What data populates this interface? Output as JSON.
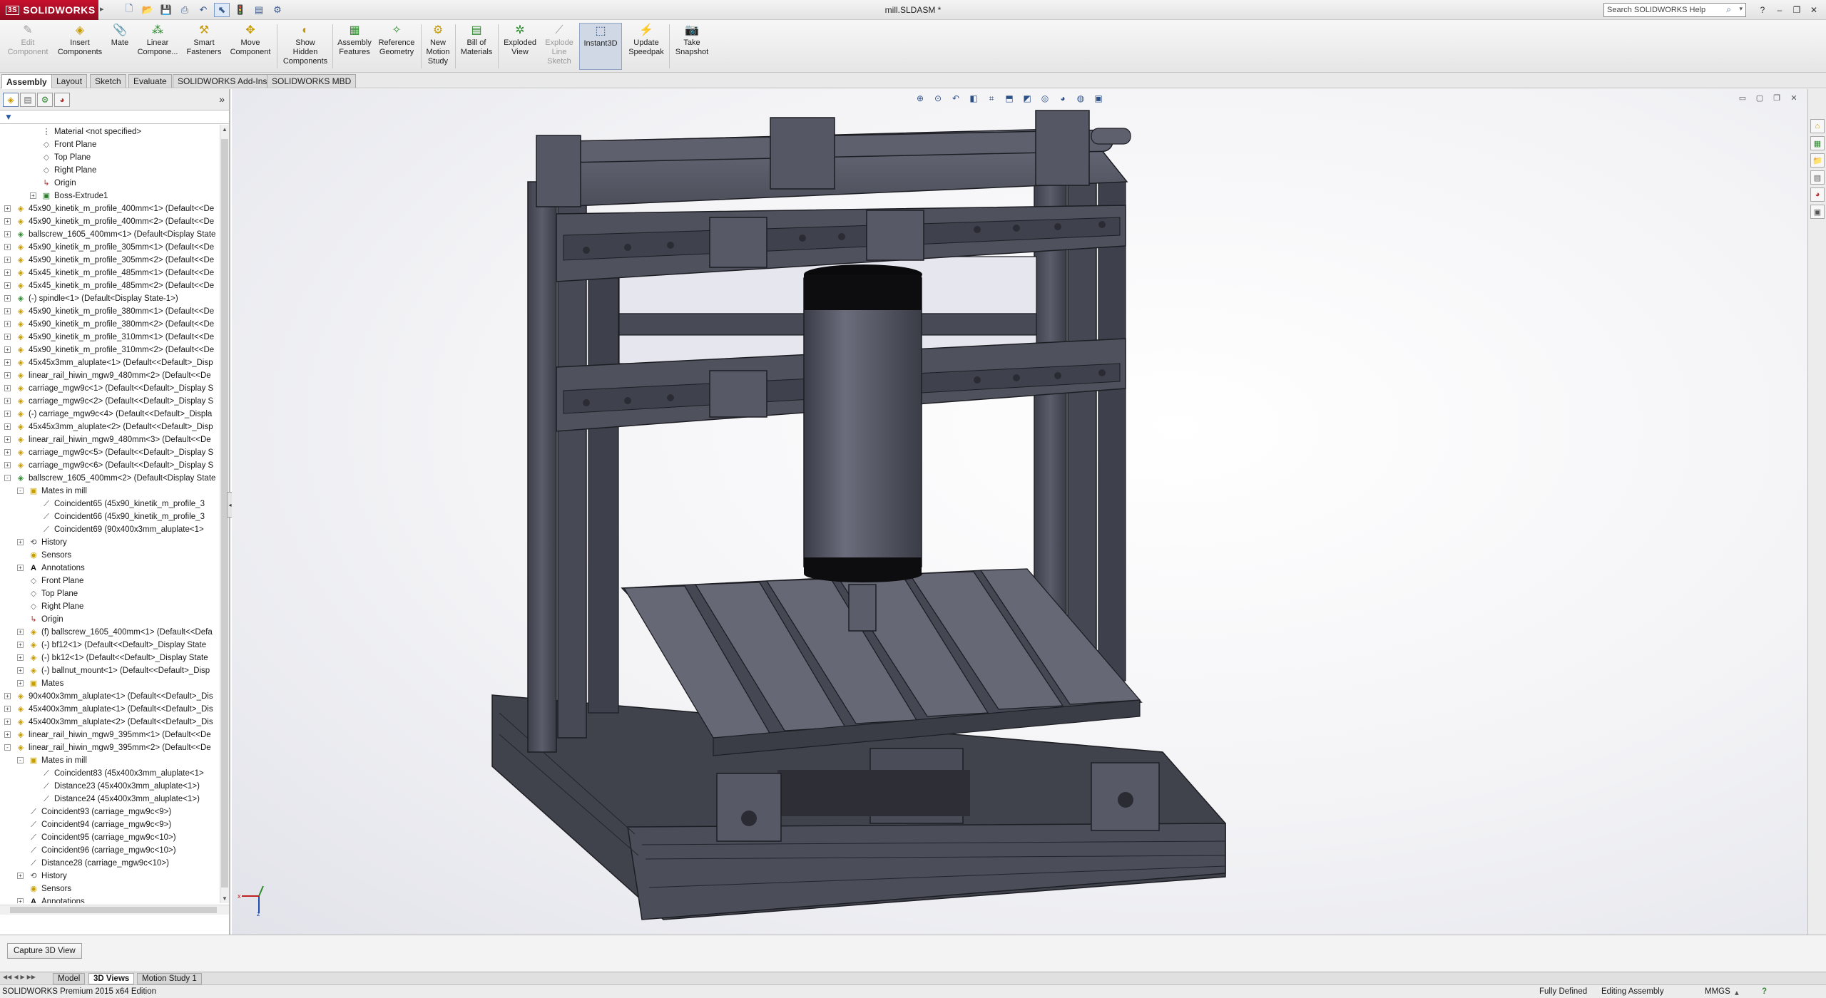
{
  "app": {
    "brand": "SOLIDWORKS",
    "brand_prefix": "3S",
    "doc_title": "mill.SLDASM *",
    "search_placeholder": "Search SOLIDWORKS Help"
  },
  "toolbar": {
    "edit_component": "Edit\nComponent",
    "insert_components": "Insert\nComponents",
    "mate": "Mate",
    "linear_component": "Linear\nCompone...",
    "smart_fasteners": "Smart\nFasteners",
    "move_component": "Move\nComponent",
    "show_hidden": "Show\nHidden\nComponents",
    "assembly_features": "Assembly\nFeatures",
    "reference_geometry": "Reference\nGeometry",
    "new_motion_study": "New\nMotion\nStudy",
    "bill_of_materials": "Bill of\nMaterials",
    "exploded_view": "Exploded\nView",
    "explode_line_sketch": "Explode\nLine\nSketch",
    "instant3d": "Instant3D",
    "update_speedpak": "Update\nSpeedpak",
    "take_snapshot": "Take\nSnapshot"
  },
  "tabs": [
    "Assembly",
    "Layout",
    "Sketch",
    "Evaluate",
    "SOLIDWORKS Add-Ins",
    "SOLIDWORKS MBD"
  ],
  "tree": [
    {
      "text": "Material <not specified>",
      "icon": "material",
      "level": 2
    },
    {
      "text": "Front Plane",
      "icon": "plane",
      "level": 2
    },
    {
      "text": "Top Plane",
      "icon": "plane",
      "level": 2
    },
    {
      "text": "Right Plane",
      "icon": "plane",
      "level": 2
    },
    {
      "text": "Origin",
      "icon": "origin",
      "level": 2
    },
    {
      "text": "Boss-Extrude1",
      "icon": "feature",
      "level": 2,
      "exp": "+"
    },
    {
      "text": "45x90_kinetik_m_profile_400mm<1> (Default<<De",
      "icon": "part",
      "level": 0,
      "exp": "+"
    },
    {
      "text": "45x90_kinetik_m_profile_400mm<2> (Default<<De",
      "icon": "part",
      "level": 0,
      "exp": "+"
    },
    {
      "text": "ballscrew_1605_400mm<1> (Default<Display State",
      "icon": "sub",
      "level": 0,
      "exp": "+"
    },
    {
      "text": "45x90_kinetik_m_profile_305mm<1> (Default<<De",
      "icon": "part",
      "level": 0,
      "exp": "+"
    },
    {
      "text": "45x90_kinetik_m_profile_305mm<2> (Default<<De",
      "icon": "part",
      "level": 0,
      "exp": "+"
    },
    {
      "text": "45x45_kinetik_m_profile_485mm<1> (Default<<De",
      "icon": "part",
      "level": 0,
      "exp": "+"
    },
    {
      "text": "45x45_kinetik_m_profile_485mm<2> (Default<<De",
      "icon": "part",
      "level": 0,
      "exp": "+"
    },
    {
      "text": "(-) spindle<1> (Default<Display State-1>)",
      "icon": "sub",
      "level": 0,
      "exp": "+"
    },
    {
      "text": "45x90_kinetik_m_profile_380mm<1> (Default<<De",
      "icon": "part",
      "level": 0,
      "exp": "+"
    },
    {
      "text": "45x90_kinetik_m_profile_380mm<2> (Default<<De",
      "icon": "part",
      "level": 0,
      "exp": "+"
    },
    {
      "text": "45x90_kinetik_m_profile_310mm<1> (Default<<De",
      "icon": "part",
      "level": 0,
      "exp": "+"
    },
    {
      "text": "45x90_kinetik_m_profile_310mm<2> (Default<<De",
      "icon": "part",
      "level": 0,
      "exp": "+"
    },
    {
      "text": "45x45x3mm_aluplate<1> (Default<<Default>_Disp",
      "icon": "part",
      "level": 0,
      "exp": "+"
    },
    {
      "text": "linear_rail_hiwin_mgw9_480mm<2> (Default<<De",
      "icon": "part",
      "level": 0,
      "exp": "+"
    },
    {
      "text": "carriage_mgw9c<1> (Default<<Default>_Display S",
      "icon": "part",
      "level": 0,
      "exp": "+"
    },
    {
      "text": "carriage_mgw9c<2> (Default<<Default>_Display S",
      "icon": "part",
      "level": 0,
      "exp": "+"
    },
    {
      "text": "(-) carriage_mgw9c<4> (Default<<Default>_Displa",
      "icon": "part",
      "level": 0,
      "exp": "+"
    },
    {
      "text": "45x45x3mm_aluplate<2> (Default<<Default>_Disp",
      "icon": "part",
      "level": 0,
      "exp": "+"
    },
    {
      "text": "linear_rail_hiwin_mgw9_480mm<3> (Default<<De",
      "icon": "part",
      "level": 0,
      "exp": "+"
    },
    {
      "text": "carriage_mgw9c<5> (Default<<Default>_Display S",
      "icon": "part",
      "level": 0,
      "exp": "+"
    },
    {
      "text": "carriage_mgw9c<6> (Default<<Default>_Display S",
      "icon": "part",
      "level": 0,
      "exp": "+"
    },
    {
      "text": "ballscrew_1605_400mm<2> (Default<Display State",
      "icon": "sub",
      "level": 0,
      "exp": "-"
    },
    {
      "text": "Mates in mill",
      "icon": "folder",
      "level": 1,
      "exp": "-"
    },
    {
      "text": "Coincident65 (45x90_kinetik_m_profile_3",
      "icon": "mate",
      "level": 2
    },
    {
      "text": "Coincident66 (45x90_kinetik_m_profile_3",
      "icon": "mate",
      "level": 2
    },
    {
      "text": "Coincident69 (90x400x3mm_aluplate<1>",
      "icon": "mate",
      "level": 2
    },
    {
      "text": "History",
      "icon": "history",
      "level": 1,
      "exp": "+"
    },
    {
      "text": "Sensors",
      "icon": "sensor",
      "level": 1
    },
    {
      "text": "Annotations",
      "icon": "annot",
      "level": 1,
      "exp": "+"
    },
    {
      "text": "Front Plane",
      "icon": "plane",
      "level": 1
    },
    {
      "text": "Top Plane",
      "icon": "plane",
      "level": 1
    },
    {
      "text": "Right Plane",
      "icon": "plane",
      "level": 1
    },
    {
      "text": "Origin",
      "icon": "origin",
      "level": 1
    },
    {
      "text": "(f) ballscrew_1605_400mm<1> (Default<<Defa",
      "icon": "part",
      "level": 1,
      "exp": "+"
    },
    {
      "text": "(-) bf12<1> (Default<<Default>_Display State",
      "icon": "part",
      "level": 1,
      "exp": "+"
    },
    {
      "text": "(-) bk12<1> (Default<<Default>_Display State",
      "icon": "part",
      "level": 1,
      "exp": "+"
    },
    {
      "text": "(-) ballnut_mount<1> (Default<<Default>_Disp",
      "icon": "part",
      "level": 1,
      "exp": "+"
    },
    {
      "text": "Mates",
      "icon": "folder",
      "level": 1,
      "exp": "+"
    },
    {
      "text": "90x400x3mm_aluplate<1> (Default<<Default>_Dis",
      "icon": "part",
      "level": 0,
      "exp": "+"
    },
    {
      "text": "45x400x3mm_aluplate<1> (Default<<Default>_Dis",
      "icon": "part",
      "level": 0,
      "exp": "+"
    },
    {
      "text": "45x400x3mm_aluplate<2> (Default<<Default>_Dis",
      "icon": "part",
      "level": 0,
      "exp": "+"
    },
    {
      "text": "linear_rail_hiwin_mgw9_395mm<1> (Default<<De",
      "icon": "part",
      "level": 0,
      "exp": "+"
    },
    {
      "text": "linear_rail_hiwin_mgw9_395mm<2> (Default<<De",
      "icon": "part",
      "level": 0,
      "exp": "-"
    },
    {
      "text": "Mates in mill",
      "icon": "folder",
      "level": 1,
      "exp": "-"
    },
    {
      "text": "Coincident83 (45x400x3mm_aluplate<1>",
      "icon": "mate",
      "level": 2
    },
    {
      "text": "Distance23 (45x400x3mm_aluplate<1>)",
      "icon": "mate",
      "level": 2
    },
    {
      "text": "Distance24 (45x400x3mm_aluplate<1>)",
      "icon": "mate",
      "level": 2
    },
    {
      "text": "Coincident93 (carriage_mgw9c<9>)",
      "icon": "mate",
      "level": 1
    },
    {
      "text": "Coincident94 (carriage_mgw9c<9>)",
      "icon": "mate",
      "level": 1
    },
    {
      "text": "Coincident95 (carriage_mgw9c<10>)",
      "icon": "mate",
      "level": 1
    },
    {
      "text": "Coincident96 (carriage_mgw9c<10>)",
      "icon": "mate",
      "level": 1
    },
    {
      "text": "Distance28 (carriage_mgw9c<10>)",
      "icon": "mate",
      "level": 1
    },
    {
      "text": "History",
      "icon": "history",
      "level": 1,
      "exp": "+"
    },
    {
      "text": "Sensors",
      "icon": "sensor",
      "level": 1
    },
    {
      "text": "Annotations",
      "icon": "annot",
      "level": 1,
      "exp": "+"
    },
    {
      "text": "Material <not specified>",
      "icon": "material",
      "level": 1,
      "selected": true
    }
  ],
  "bottom": {
    "capture_label": "Capture 3D View",
    "sheet_tabs": [
      "Model",
      "3D Views",
      "Motion Study 1"
    ]
  },
  "status": {
    "edition": "SOLIDWORKS Premium 2015 x64 Edition",
    "defined": "Fully Defined",
    "mode": "Editing Assembly",
    "units": "MMGS"
  },
  "colors": {
    "accent": "#3399ff",
    "brand": "#c8102e",
    "model_body": "#4d4f5c",
    "model_dark": "#2e3038"
  }
}
